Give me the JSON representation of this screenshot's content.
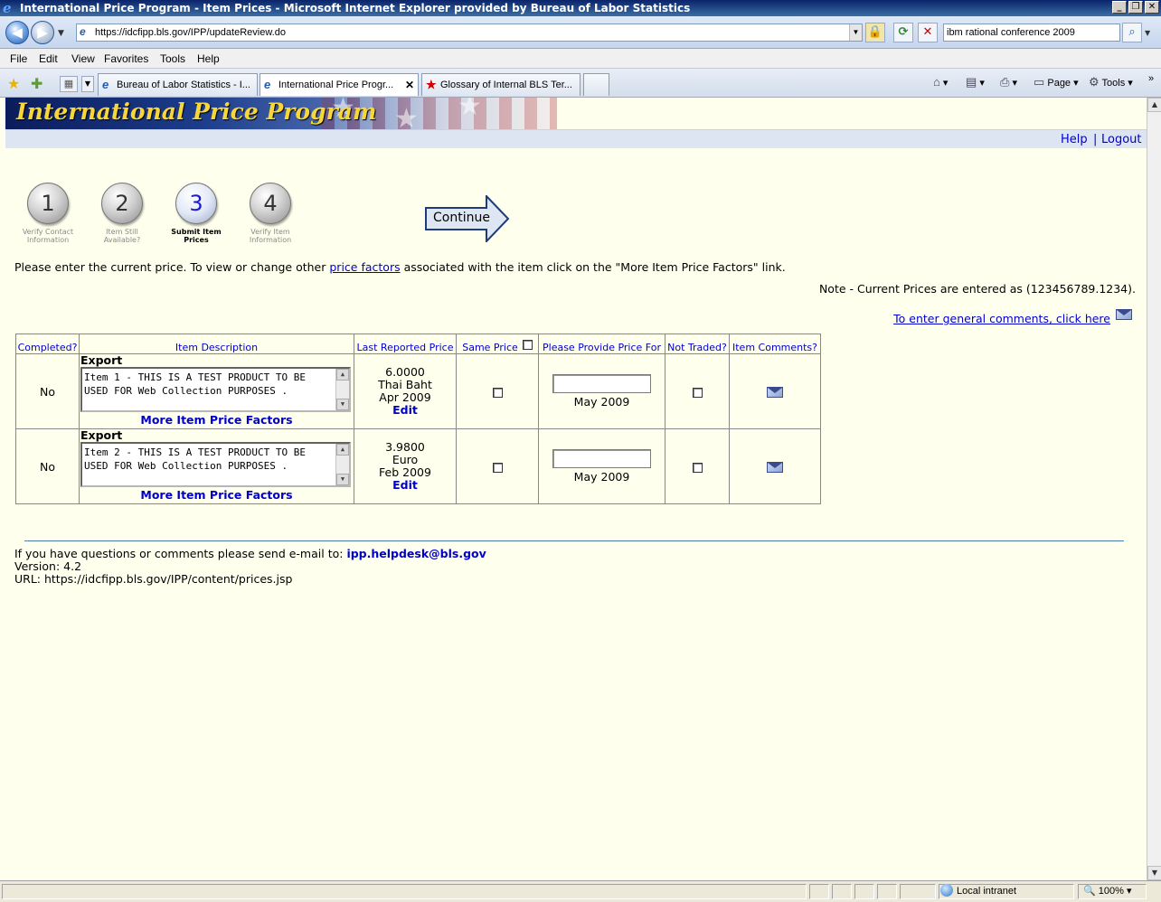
{
  "window": {
    "title": "International Price Program - Item Prices - Microsoft Internet Explorer provided by Bureau of Labor Statistics",
    "buttons": {
      "minimize": "_",
      "restore": "❐",
      "close": "✕"
    }
  },
  "addressbar": {
    "url": "https://idcfipp.bls.gov/IPP/updateReview.do",
    "search_value": "ibm rational conference 2009"
  },
  "menu": {
    "file": "File",
    "edit": "Edit",
    "view": "View",
    "favorites": "Favorites",
    "tools": "Tools",
    "help": "Help"
  },
  "tabs": [
    {
      "label": "Bureau of Labor Statistics - I...",
      "active": false
    },
    {
      "label": "International Price Progr...",
      "active": true
    },
    {
      "label": "Glossary of Internal BLS Ter...",
      "active": false
    }
  ],
  "commandbar": {
    "page": "Page",
    "tools": "Tools"
  },
  "banner": {
    "title": "International Price Program"
  },
  "topnav": {
    "help": "Help",
    "separator": "|",
    "logout": "Logout"
  },
  "steps": [
    {
      "number": "1",
      "label": "Verify Contact Information",
      "current": false
    },
    {
      "number": "2",
      "label": "Item Still Available?",
      "current": false
    },
    {
      "number": "3",
      "label": "Submit Item Prices",
      "current": true
    },
    {
      "number": "4",
      "label": "Verify Item Information",
      "current": false
    }
  ],
  "continue_label": "Continue",
  "instructions": {
    "before": "Please enter the current price. To view or change other ",
    "link": "price factors",
    "after": " associated with the item click on the \"More Item Price Factors\" link."
  },
  "note": "Note - Current Prices are entered as (123456789.1234).",
  "general_comments_link": "To enter general comments, click here",
  "table": {
    "headers": {
      "completed": "Completed?",
      "description": "Item Description",
      "last_reported": "Last Reported Price",
      "same_price": "Same Price",
      "provide_price": "Please Provide Price For",
      "not_traded": "Not Traded?",
      "comments": "Item Comments?"
    },
    "rows": [
      {
        "completed": "No",
        "type": "Export",
        "description": "Item 1 - THIS IS A TEST PRODUCT TO BE USED FOR Web Collection PURPOSES .",
        "more_link": "More Item Price Factors",
        "last_price": "6.0000",
        "currency": "Thai Baht",
        "last_period": "Apr 2009",
        "edit": "Edit",
        "provide_period": "May 2009",
        "price_value": ""
      },
      {
        "completed": "No",
        "type": "Export",
        "description": "Item 2  - THIS IS A TEST PRODUCT TO BE USED FOR Web Collection PURPOSES .",
        "more_link": "More Item Price Factors",
        "last_price": "3.9800",
        "currency": "Euro",
        "last_period": "Feb 2009",
        "edit": "Edit",
        "provide_period": "May 2009",
        "price_value": ""
      }
    ]
  },
  "footer": {
    "question": "If you have questions or comments please send e-mail to: ",
    "email": "ipp.helpdesk@bls.gov",
    "version": "Version: 4.2",
    "url": "URL: https://idcfipp.bls.gov/IPP/content/prices.jsp"
  },
  "statusbar": {
    "zone": "Local intranet",
    "zoom": "100%"
  }
}
